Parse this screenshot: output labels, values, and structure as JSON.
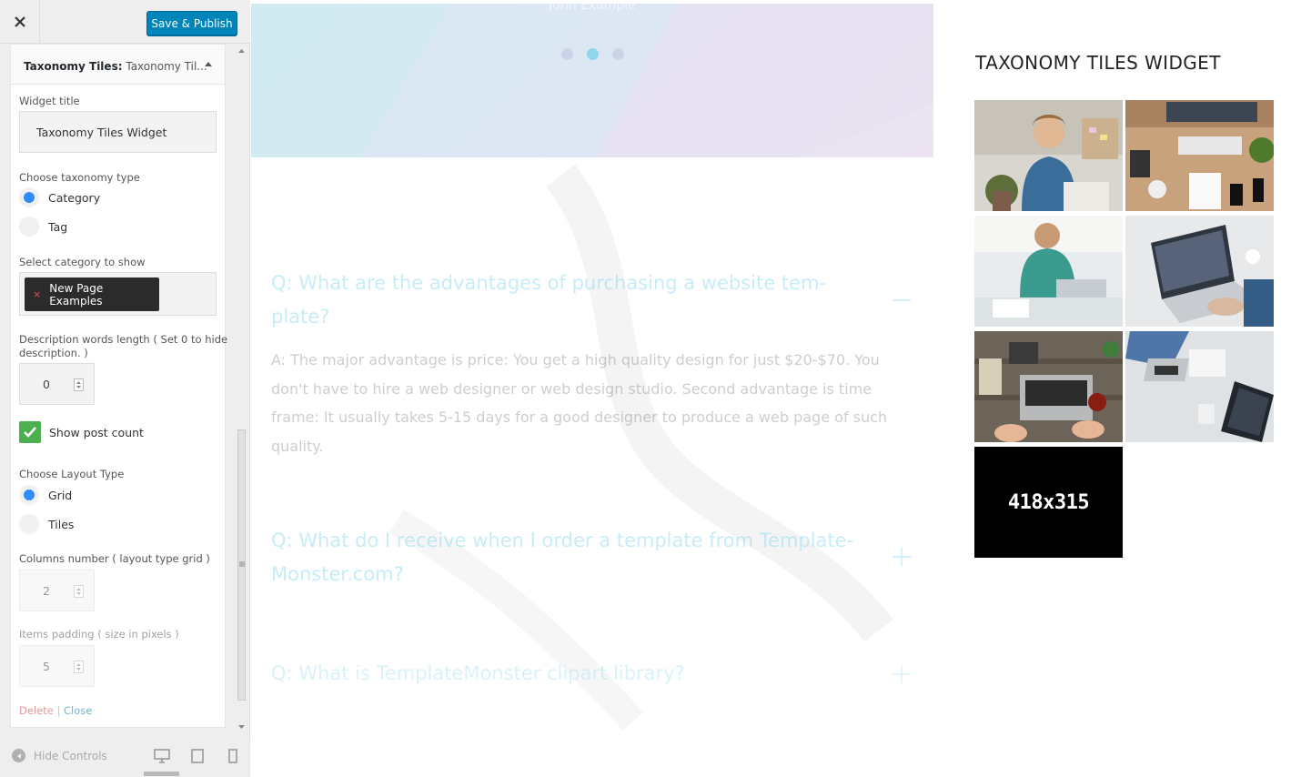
{
  "header": {
    "close_icon": "close-icon",
    "save_label": "Save & Publish",
    "save_color": "#0085ba"
  },
  "widget": {
    "title_bold": "Taxonomy Tiles:",
    "title_rest": "Taxonomy Til...",
    "widget_title_label": "Widget title",
    "widget_title_value": "Taxonomy Tiles Widget",
    "taxonomy_label": "Choose taxonomy type",
    "taxonomy_options": [
      "Category",
      "Tag"
    ],
    "taxonomy_selected": "Category",
    "category_label": "Select category to show",
    "category_chip": "New Page Examples",
    "category_chip_remove": "×",
    "desc_label_line1": "Description words length ( Set 0 to hide",
    "desc_label_line2": "description. )",
    "desc_value": "0",
    "show_count_label": "Show post count",
    "show_count_checked": true,
    "layout_label": "Choose Layout Type",
    "layout_options": [
      "Grid",
      "Tiles"
    ],
    "layout_selected": "Grid",
    "columns_label": "Columns number ( layout type grid )",
    "columns_value": "2",
    "padding_label": "Items padding ( size in pixels )",
    "padding_value": "5",
    "delete_label": "Delete",
    "separator": "|",
    "close_label": "Close"
  },
  "footer": {
    "hide_controls_label": "Hide Controls",
    "device_icons": [
      "desktop-icon",
      "tablet-icon",
      "mobile-icon"
    ]
  },
  "preview": {
    "hero_caption": "John Example",
    "slider_dots": 3,
    "faq": [
      {
        "q_line1": "Q: What are the advantages of purchasing a website tem-",
        "q_line2": "plate?",
        "toggle": "minus"
      },
      {
        "q_line1": "Q: What do I receive when I order a template from Template-",
        "q_line2": "Monster.com?",
        "toggle": "plus"
      },
      {
        "q_line1": "Q: What is TemplateMonster clipart library?",
        "q_line2": "",
        "toggle": "plus"
      }
    ],
    "faq_answer_lines": [
      "A: The major advantage is price: You get a high quality design for just $20-$70. You",
      "don't have to hire a web designer or web design studio. Second advantage is time",
      "frame: It usually takes 5-15 days for a good designer to produce a web page of such",
      "quality."
    ],
    "sidebar_title": "TAXONOMY TILES WIDGET",
    "placeholder_text": "418x315",
    "accent_color": "#82d7ee"
  }
}
